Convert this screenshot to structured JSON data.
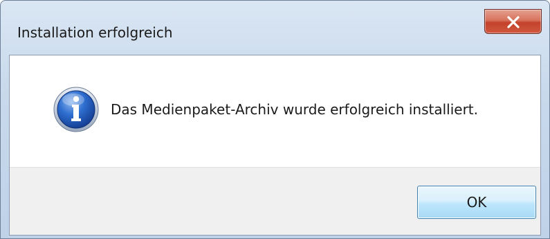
{
  "dialog": {
    "title": "Installation erfolgreich",
    "message": "Das Medienpaket-Archiv wurde erfolgreich installiert.",
    "icon": "info-icon",
    "ok_label": "OK",
    "close_icon": "close-icon"
  },
  "colors": {
    "close_button": "#c4412a",
    "ok_button_border": "#3c7fb1",
    "button_area": "#f0f0f0",
    "info_icon": "#1f56b8"
  }
}
